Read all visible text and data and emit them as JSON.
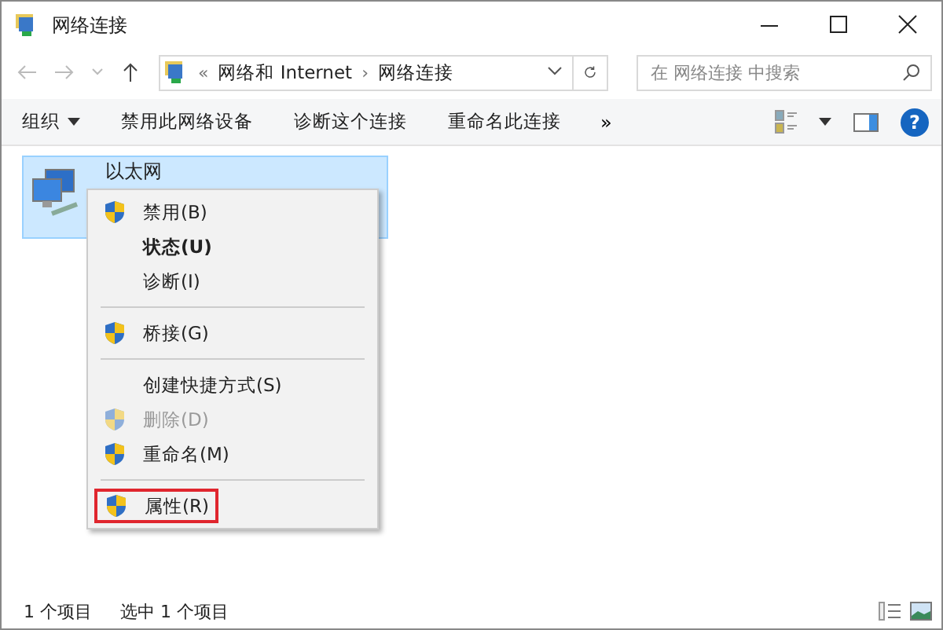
{
  "window": {
    "title": "网络连接"
  },
  "address": {
    "overflow": "«",
    "crumbs": [
      "网络和 Internet",
      "网络连接"
    ],
    "separator": "›"
  },
  "search": {
    "placeholder": "在 网络连接 中搜索"
  },
  "toolbar": {
    "items": [
      {
        "label": "组织",
        "dropdown": true
      },
      {
        "label": "禁用此网络设备",
        "dropdown": false
      },
      {
        "label": "诊断这个连接",
        "dropdown": false
      },
      {
        "label": "重命名此连接",
        "dropdown": false
      }
    ],
    "more": "»",
    "help": "?"
  },
  "connections": [
    {
      "name": "以太网",
      "selected": true
    }
  ],
  "context_menu": [
    {
      "kind": "item",
      "label": "禁用(B)",
      "shield": true,
      "bold": false,
      "disabled": false,
      "highlighted": false
    },
    {
      "kind": "item",
      "label": "状态(U)",
      "shield": false,
      "bold": true,
      "disabled": false,
      "highlighted": false
    },
    {
      "kind": "item",
      "label": "诊断(I)",
      "shield": false,
      "bold": false,
      "disabled": false,
      "highlighted": false
    },
    {
      "kind": "separator"
    },
    {
      "kind": "item",
      "label": "桥接(G)",
      "shield": true,
      "bold": false,
      "disabled": false,
      "highlighted": false
    },
    {
      "kind": "separator"
    },
    {
      "kind": "item",
      "label": "创建快捷方式(S)",
      "shield": false,
      "bold": false,
      "disabled": false,
      "highlighted": false
    },
    {
      "kind": "item",
      "label": "删除(D)",
      "shield": true,
      "bold": false,
      "disabled": true,
      "highlighted": false
    },
    {
      "kind": "item",
      "label": "重命名(M)",
      "shield": true,
      "bold": false,
      "disabled": false,
      "highlighted": false
    },
    {
      "kind": "separator"
    },
    {
      "kind": "item",
      "label": "属性(R)",
      "shield": true,
      "bold": false,
      "disabled": false,
      "highlighted": true
    }
  ],
  "status_bar": {
    "count": "1 个项目",
    "selection": "选中 1 个项目"
  }
}
